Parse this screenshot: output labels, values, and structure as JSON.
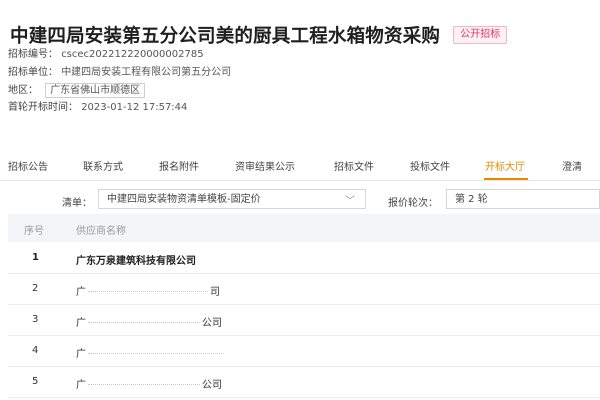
{
  "header": {
    "title": "中建四局安装第五分公司美的厨具工程水箱物资采购",
    "badge": "公开招标",
    "tender_no_label": "招标编号：",
    "tender_no": "cscec202212220000002785",
    "org_label": "招标单位：",
    "org": "中建四局安装工程有限公司第五分公司",
    "region_label": "地区：",
    "region": "广东省佛山市顺德区",
    "open_time_label": "首轮开标时间：",
    "open_time": "2023-01-12 17:57:44"
  },
  "tabs": [
    {
      "label": "招标公告"
    },
    {
      "label": "联系方式"
    },
    {
      "label": "报名附件"
    },
    {
      "label": "资审结果公示"
    },
    {
      "label": "招标文件"
    },
    {
      "label": "投标文件"
    },
    {
      "label": "开标大厅",
      "active": true
    },
    {
      "label": "澄清"
    }
  ],
  "filters": {
    "list_label": "清单：",
    "list_value": "中建四局安装物资清单模板-固定价",
    "round_label": "报价轮次：",
    "round_value": "第 2 轮"
  },
  "table": {
    "headers": [
      "序号",
      "供应商名称"
    ],
    "rows": [
      {
        "num": "1",
        "prefix": "广东万泉建筑科技有限公司",
        "suffix": ""
      },
      {
        "num": "2",
        "prefix": "广",
        "suffix": "司"
      },
      {
        "num": "3",
        "prefix": "广",
        "suffix": "公司"
      },
      {
        "num": "4",
        "prefix": "广",
        "suffix": ""
      },
      {
        "num": "5",
        "prefix": "广",
        "suffix": "公司"
      }
    ]
  },
  "colors": {
    "accent": "#e58a00",
    "badge_text": "#e2336b",
    "header_row_bg": "#f4f5f7"
  }
}
